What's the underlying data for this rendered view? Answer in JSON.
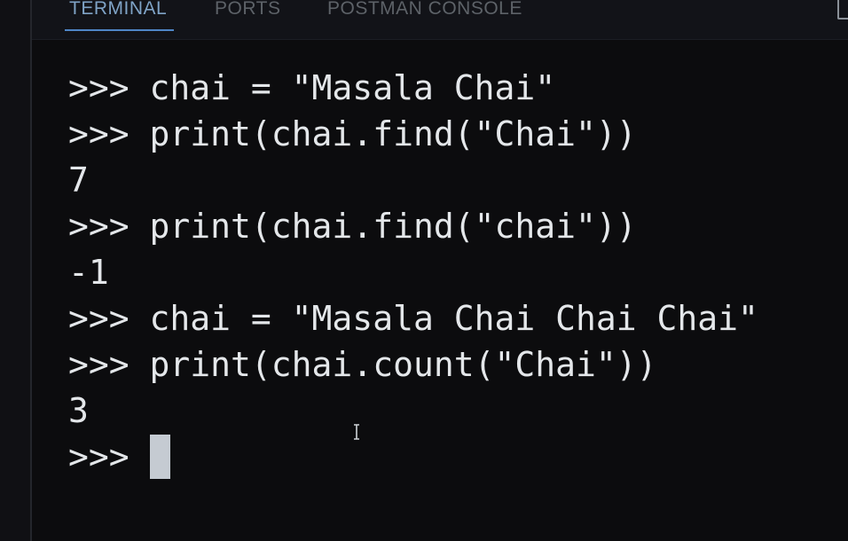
{
  "tabs": [
    {
      "label": "TERMINAL",
      "active": true
    },
    {
      "label": "PORTS",
      "active": false
    },
    {
      "label": "POSTMAN CONSOLE",
      "active": false
    }
  ],
  "terminal": {
    "prompt": ">>>",
    "lines": [
      {
        "kind": "input",
        "text": "chai = \"Masala Chai\""
      },
      {
        "kind": "input",
        "text": "print(chai.find(\"Chai\"))"
      },
      {
        "kind": "output",
        "text": "7"
      },
      {
        "kind": "input",
        "text": "print(chai.find(\"chai\"))"
      },
      {
        "kind": "output",
        "text": "-1"
      },
      {
        "kind": "input",
        "text": "chai = \"Masala Chai Chai Chai\""
      },
      {
        "kind": "input",
        "text": "print(chai.count(\"Chai\"))"
      },
      {
        "kind": "output",
        "text": "3"
      }
    ]
  },
  "colors": {
    "background": "#0c0c0e",
    "text": "#e4e7ea",
    "active_tab": "#7fa3c6",
    "inactive_tab": "#5d6268",
    "tab_underline": "#4f86c6",
    "cursor": "#c5cbd2"
  },
  "icons": {
    "panel_action": "panel-toggle-icon",
    "pointer": "text-cursor-icon"
  }
}
